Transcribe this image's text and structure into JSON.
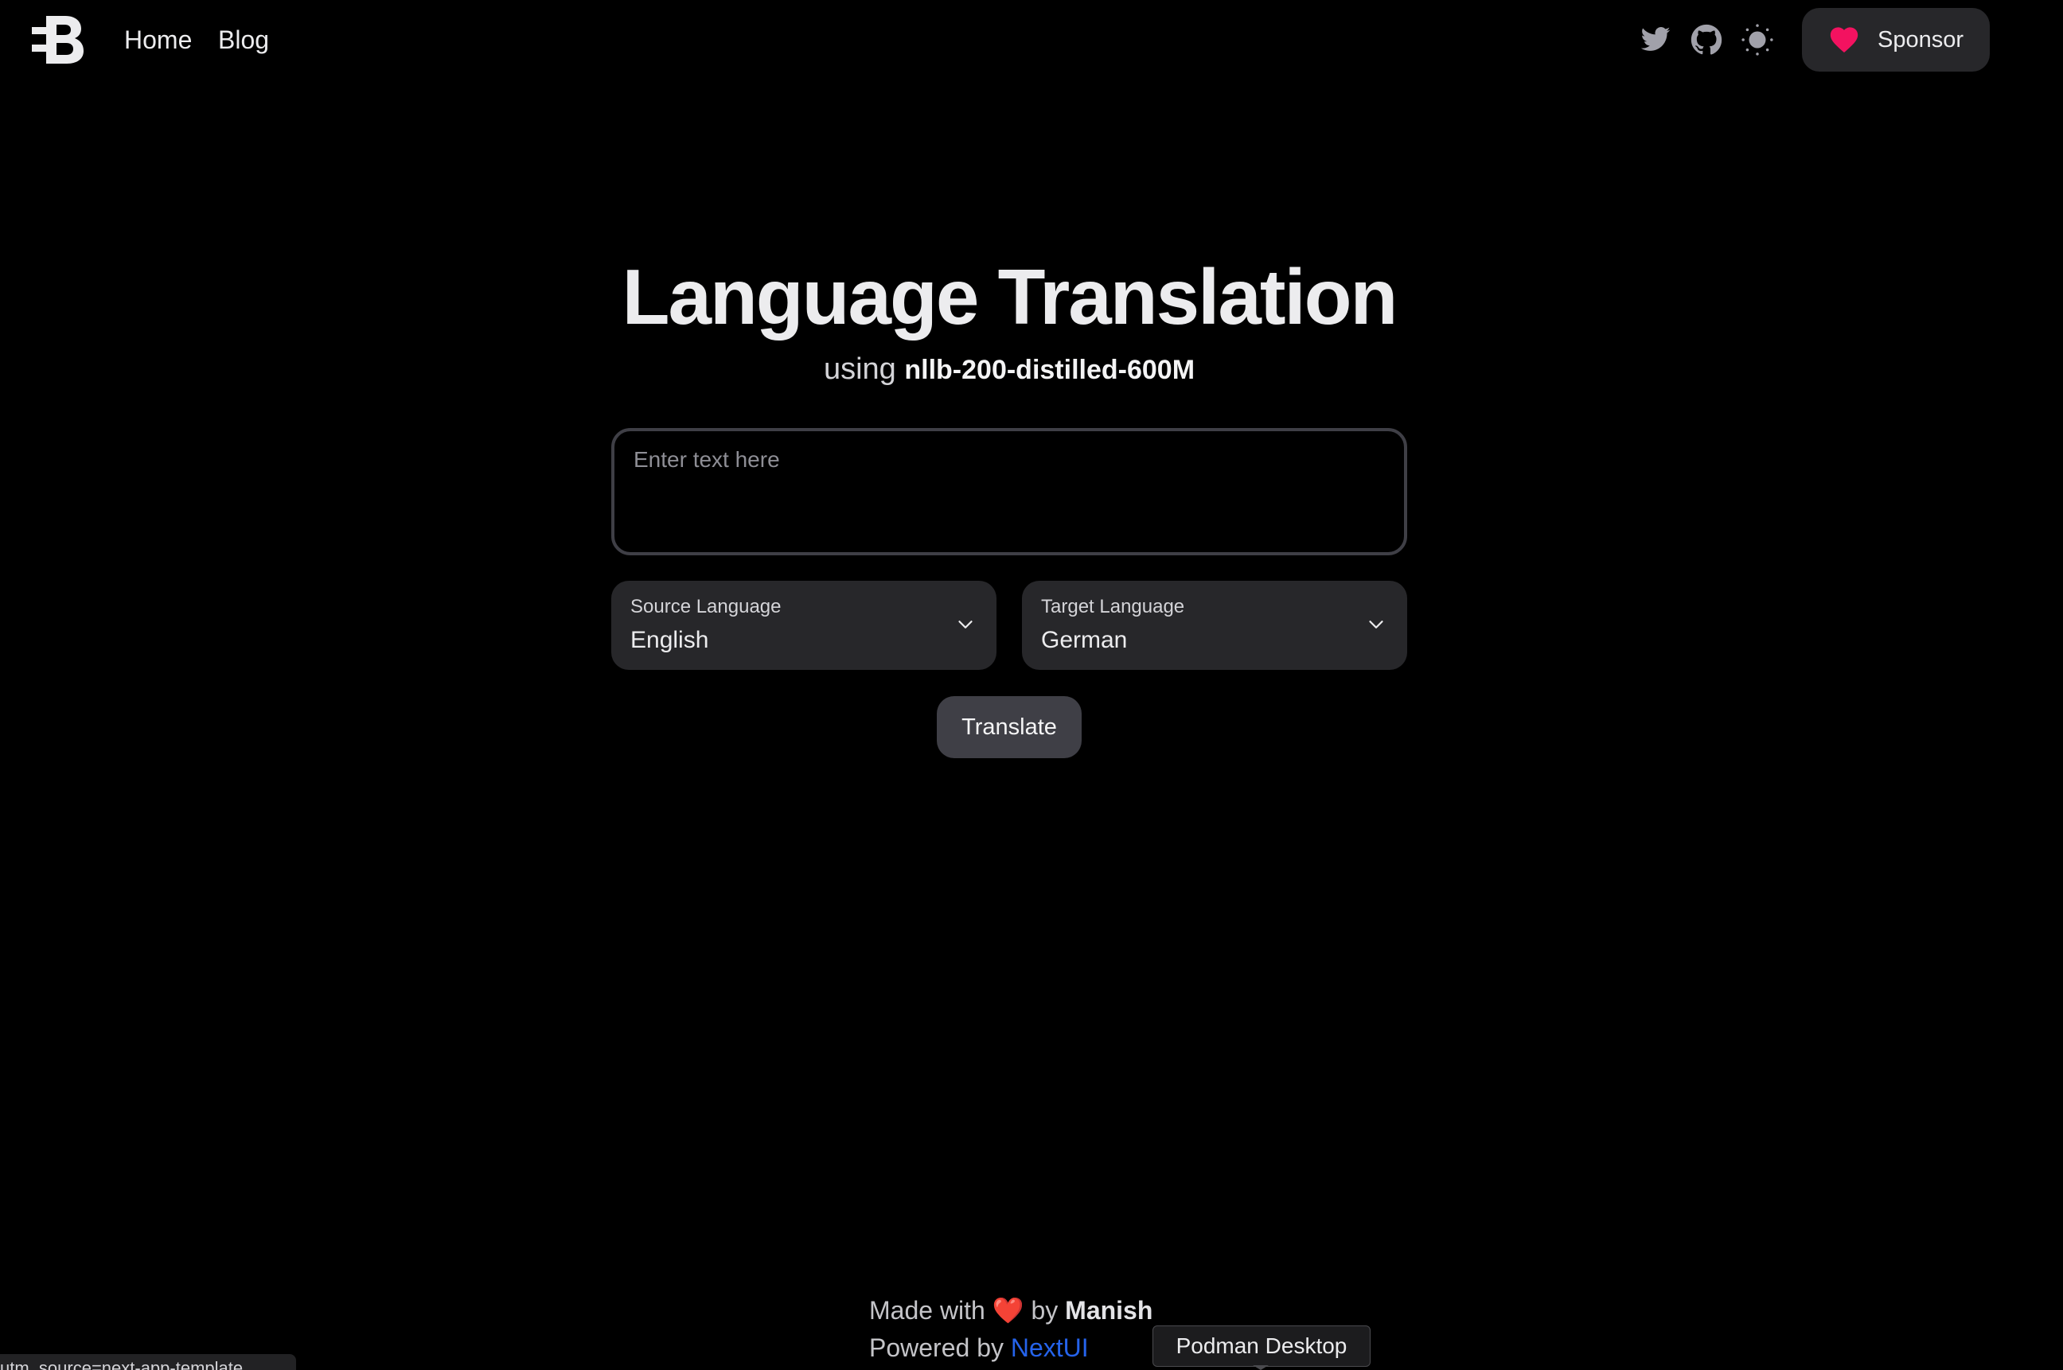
{
  "navbar": {
    "logo_icon": "brand-b-logo",
    "links": [
      {
        "label": "Home"
      },
      {
        "label": "Blog"
      }
    ],
    "icons": [
      "twitter-icon",
      "github-icon",
      "sun-icon"
    ],
    "sponsor": {
      "label": "Sponsor",
      "icon": "heart-icon",
      "icon_color": "#f31260"
    }
  },
  "hero": {
    "title": "Language Translation",
    "subtitle_prefix": "using",
    "model_name": "nllb-200-distilled-600M"
  },
  "form": {
    "input": {
      "value": "",
      "placeholder": "Enter text here"
    },
    "source": {
      "label": "Source Language",
      "value": "English"
    },
    "target": {
      "label": "Target Language",
      "value": "German"
    },
    "submit_label": "Translate"
  },
  "footer": {
    "made_prefix": "Made with",
    "heart": "❤️",
    "made_by": "by",
    "author": "Manish",
    "powered_prefix": "Powered by",
    "powered_link": "NextUI",
    "link_color": "#2563eb"
  },
  "tooltip": {
    "text": "Podman Desktop"
  },
  "status_bar": {
    "text": "utm_source=next-app-template"
  },
  "colors": {
    "background": "#000000",
    "surface": "#27272a",
    "button": "#3f3f46",
    "text": "#ececee"
  }
}
